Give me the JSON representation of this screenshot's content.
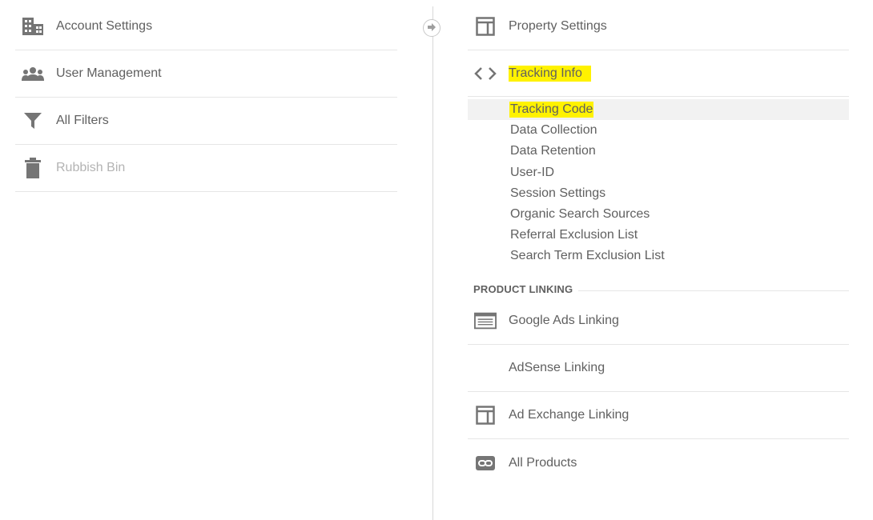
{
  "account": {
    "items": [
      {
        "label": "Account Settings",
        "icon": "building-icon"
      },
      {
        "label": "User Management",
        "icon": "people-icon"
      },
      {
        "label": "All Filters",
        "icon": "filter-icon"
      },
      {
        "label": "Rubbish Bin",
        "icon": "trash-icon"
      }
    ]
  },
  "property": {
    "settings_label": "Property Settings",
    "tracking_info_label": "Tracking Info",
    "tracking_sub": [
      "Tracking Code",
      "Data Collection",
      "Data Retention",
      "User-ID",
      "Session Settings",
      "Organic Search Sources",
      "Referral Exclusion List",
      "Search Term Exclusion List"
    ],
    "product_linking_header": "PRODUCT LINKING",
    "linking": [
      {
        "label": "Google Ads Linking",
        "icon": "ads-icon"
      },
      {
        "label": "AdSense Linking",
        "icon": ""
      },
      {
        "label": "Ad Exchange Linking",
        "icon": "layout-icon"
      },
      {
        "label": "All Products",
        "icon": "link-icon"
      }
    ]
  },
  "colors": {
    "highlight": "#fff200",
    "text": "#606060",
    "disabled": "#b3b3b3"
  }
}
